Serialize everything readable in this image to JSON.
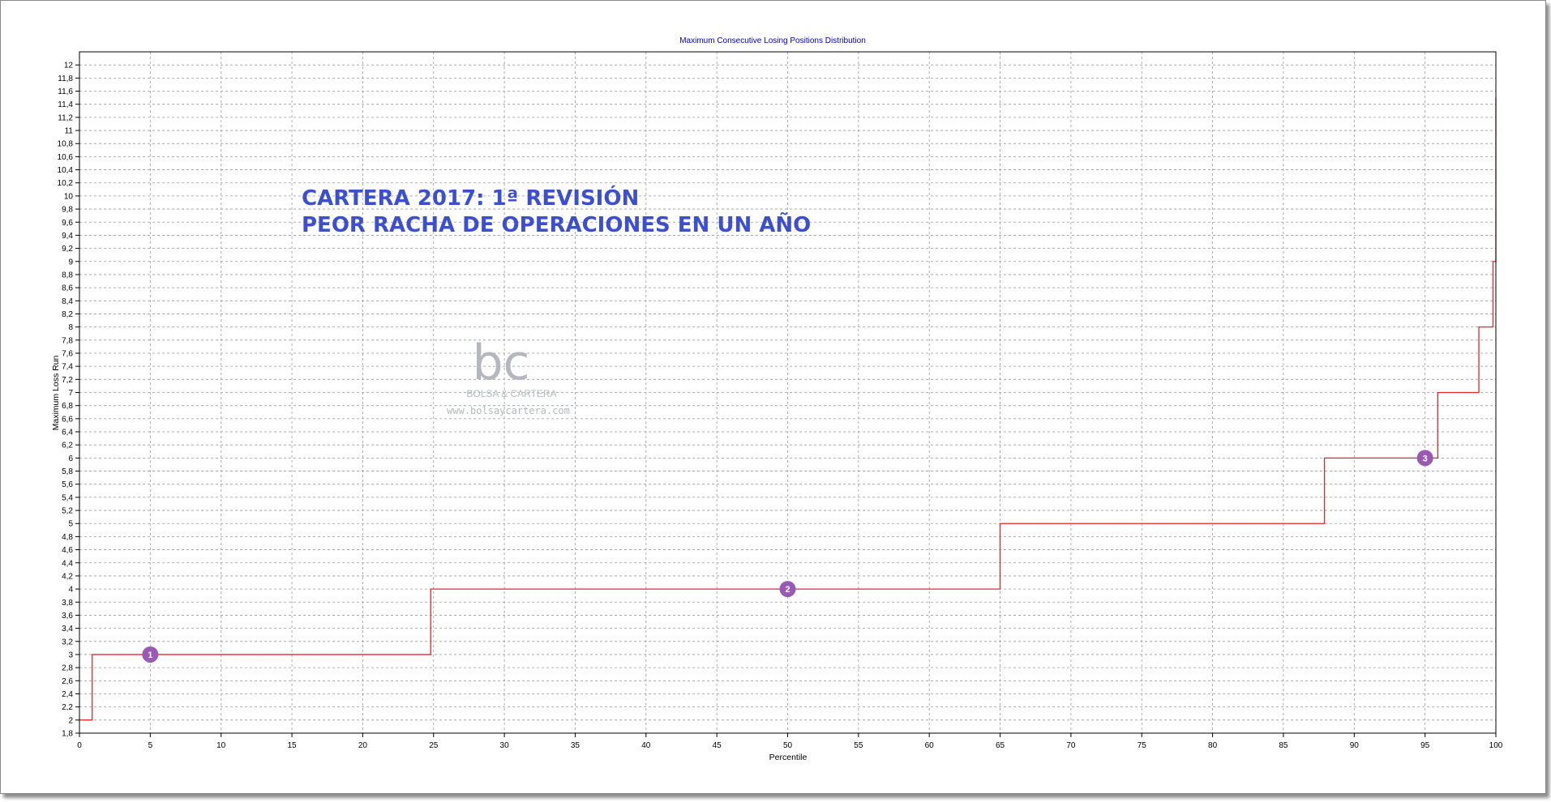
{
  "chart_data": {
    "type": "line",
    "title": "Maximum Consecutive Losing Positions Distribution",
    "xlabel": "Percentile",
    "ylabel": "Maximum Loss Run",
    "xlim": [
      0,
      100
    ],
    "ylim": [
      1.8,
      12.2
    ],
    "x_ticks": [
      "0",
      "5",
      "10",
      "15",
      "20",
      "25",
      "30",
      "35",
      "40",
      "45",
      "50",
      "55",
      "60",
      "65",
      "70",
      "75",
      "80",
      "85",
      "90",
      "95",
      "100"
    ],
    "y_ticks": [
      "1,8",
      "2",
      "2,2",
      "2,4",
      "2,6",
      "2,8",
      "3",
      "3,2",
      "3,4",
      "3,6",
      "3,8",
      "4",
      "4,2",
      "4,4",
      "4,6",
      "4,8",
      "5",
      "5,2",
      "5,4",
      "5,6",
      "5,8",
      "6",
      "6,2",
      "6,4",
      "6,6",
      "6,8",
      "7",
      "7,2",
      "7,4",
      "7,6",
      "7,8",
      "8",
      "8,2",
      "8,4",
      "8,6",
      "8,8",
      "9",
      "9,2",
      "9,4",
      "9,6",
      "9,8",
      "10",
      "10,2",
      "10,4",
      "10,6",
      "10,8",
      "11",
      "11,2",
      "11,4",
      "11,6",
      "11,8",
      "12"
    ],
    "grid": true,
    "line_color": "#e8262a",
    "series": [
      {
        "step": "post",
        "x": [
          0,
          0.9,
          24.8,
          65.0,
          87.9,
          95.9,
          98.8,
          99.8,
          100.0
        ],
        "y": [
          2,
          3,
          4,
          5,
          6,
          7,
          8,
          9,
          11.5
        ]
      }
    ],
    "annotations": [
      {
        "label": "1",
        "x": 5,
        "y": 3
      },
      {
        "label": "2",
        "x": 50,
        "y": 4
      },
      {
        "label": "3",
        "x": 95,
        "y": 6
      }
    ]
  },
  "overlay_text": {
    "line1": "CARTERA 2017: 1ª REVISIÓN",
    "line2": "PEOR RACHA DE OPERACIONES EN UN AÑO"
  },
  "watermark": {
    "name": "BOLSA & CARTERA",
    "url": "www.bolsaycartera.com",
    "color": "#b4b8be"
  },
  "colors": {
    "badge": "#9b59b6",
    "title": "#0000cc",
    "overlay": "#3b4fcf"
  }
}
